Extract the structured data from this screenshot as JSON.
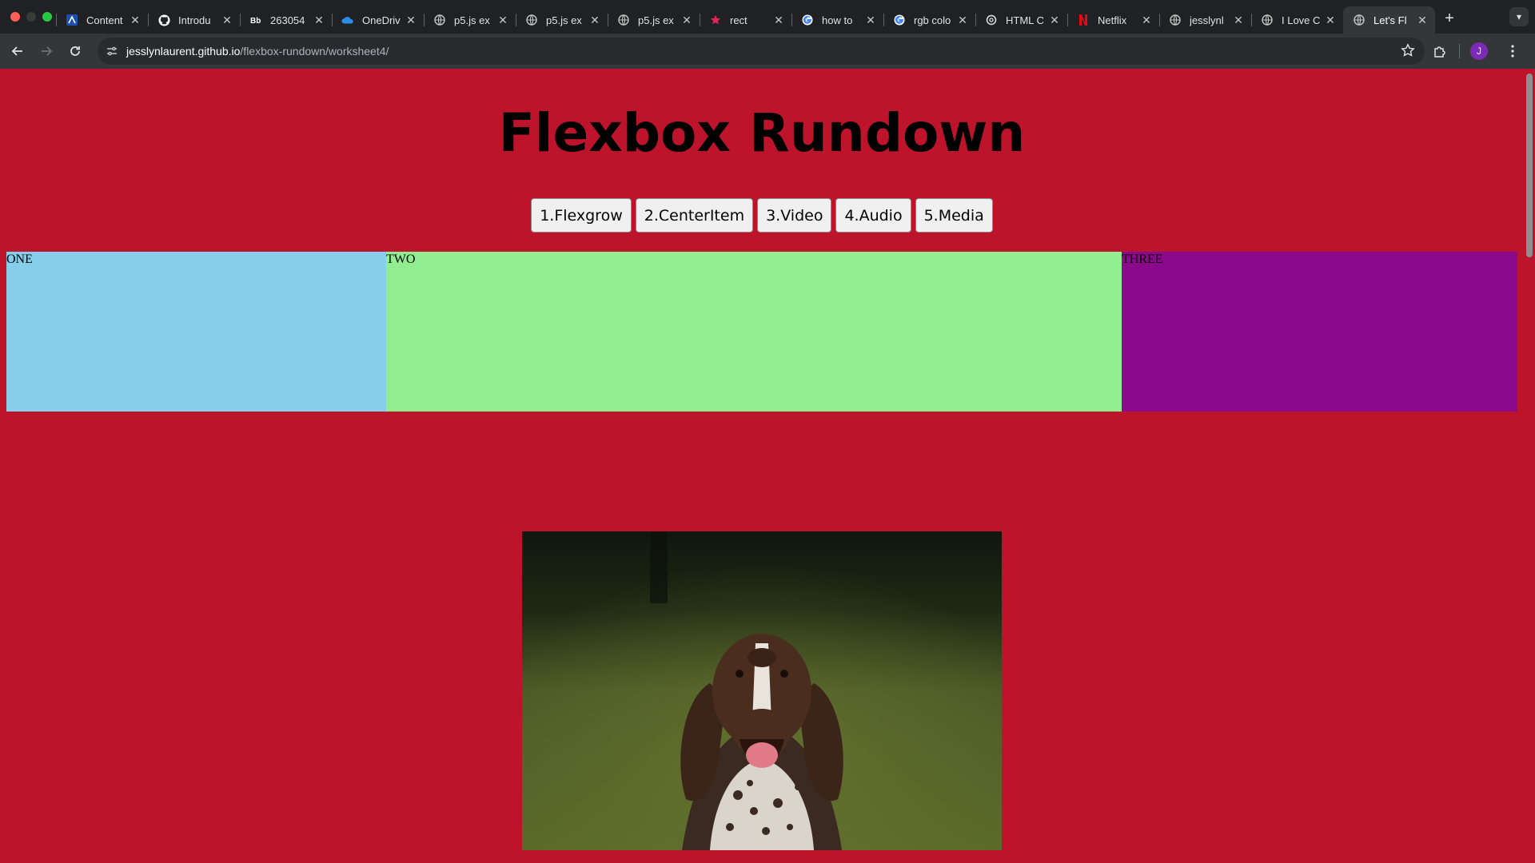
{
  "browser": {
    "tabs": [
      {
        "title": "Content",
        "icon": "canvas-icon",
        "active": false
      },
      {
        "title": "Introdu",
        "icon": "github-icon",
        "active": false
      },
      {
        "title": "263054",
        "icon": "blackboard-icon",
        "active": false
      },
      {
        "title": "OneDriv",
        "icon": "onedrive-icon",
        "active": false
      },
      {
        "title": "p5.js ex",
        "icon": "globe-icon",
        "active": false
      },
      {
        "title": "p5.js ex",
        "icon": "globe-icon",
        "active": false
      },
      {
        "title": "p5.js ex",
        "icon": "globe-icon",
        "active": false
      },
      {
        "title": "rect",
        "icon": "star-icon",
        "active": false
      },
      {
        "title": "how to",
        "icon": "google-icon",
        "active": false
      },
      {
        "title": "rgb colo",
        "icon": "google-icon",
        "active": false
      },
      {
        "title": "HTML C",
        "icon": "openai-icon",
        "active": false
      },
      {
        "title": "Netflix",
        "icon": "netflix-icon",
        "active": false
      },
      {
        "title": "jesslynl",
        "icon": "globe-icon",
        "active": false
      },
      {
        "title": "I Love C",
        "icon": "globe-icon",
        "active": false
      },
      {
        "title": "Let's Fl",
        "icon": "globe-icon",
        "active": true
      }
    ],
    "url_host": "jesslynlaurent.github.io",
    "url_path": "/flexbox-rundown/worksheet4/",
    "profile_initial": "J"
  },
  "page": {
    "title": "Flexbox Rundown",
    "nav": [
      "1.Flexgrow",
      "2.CenterItem",
      "3.Video",
      "4.Audio",
      "5.Media"
    ],
    "boxes": {
      "one": "ONE",
      "two": "TWO",
      "three": "THREE"
    },
    "colors": {
      "background": "#bd132b",
      "one": "#87ceeb",
      "two": "#90ee90",
      "three": "#8b0a8b"
    }
  }
}
